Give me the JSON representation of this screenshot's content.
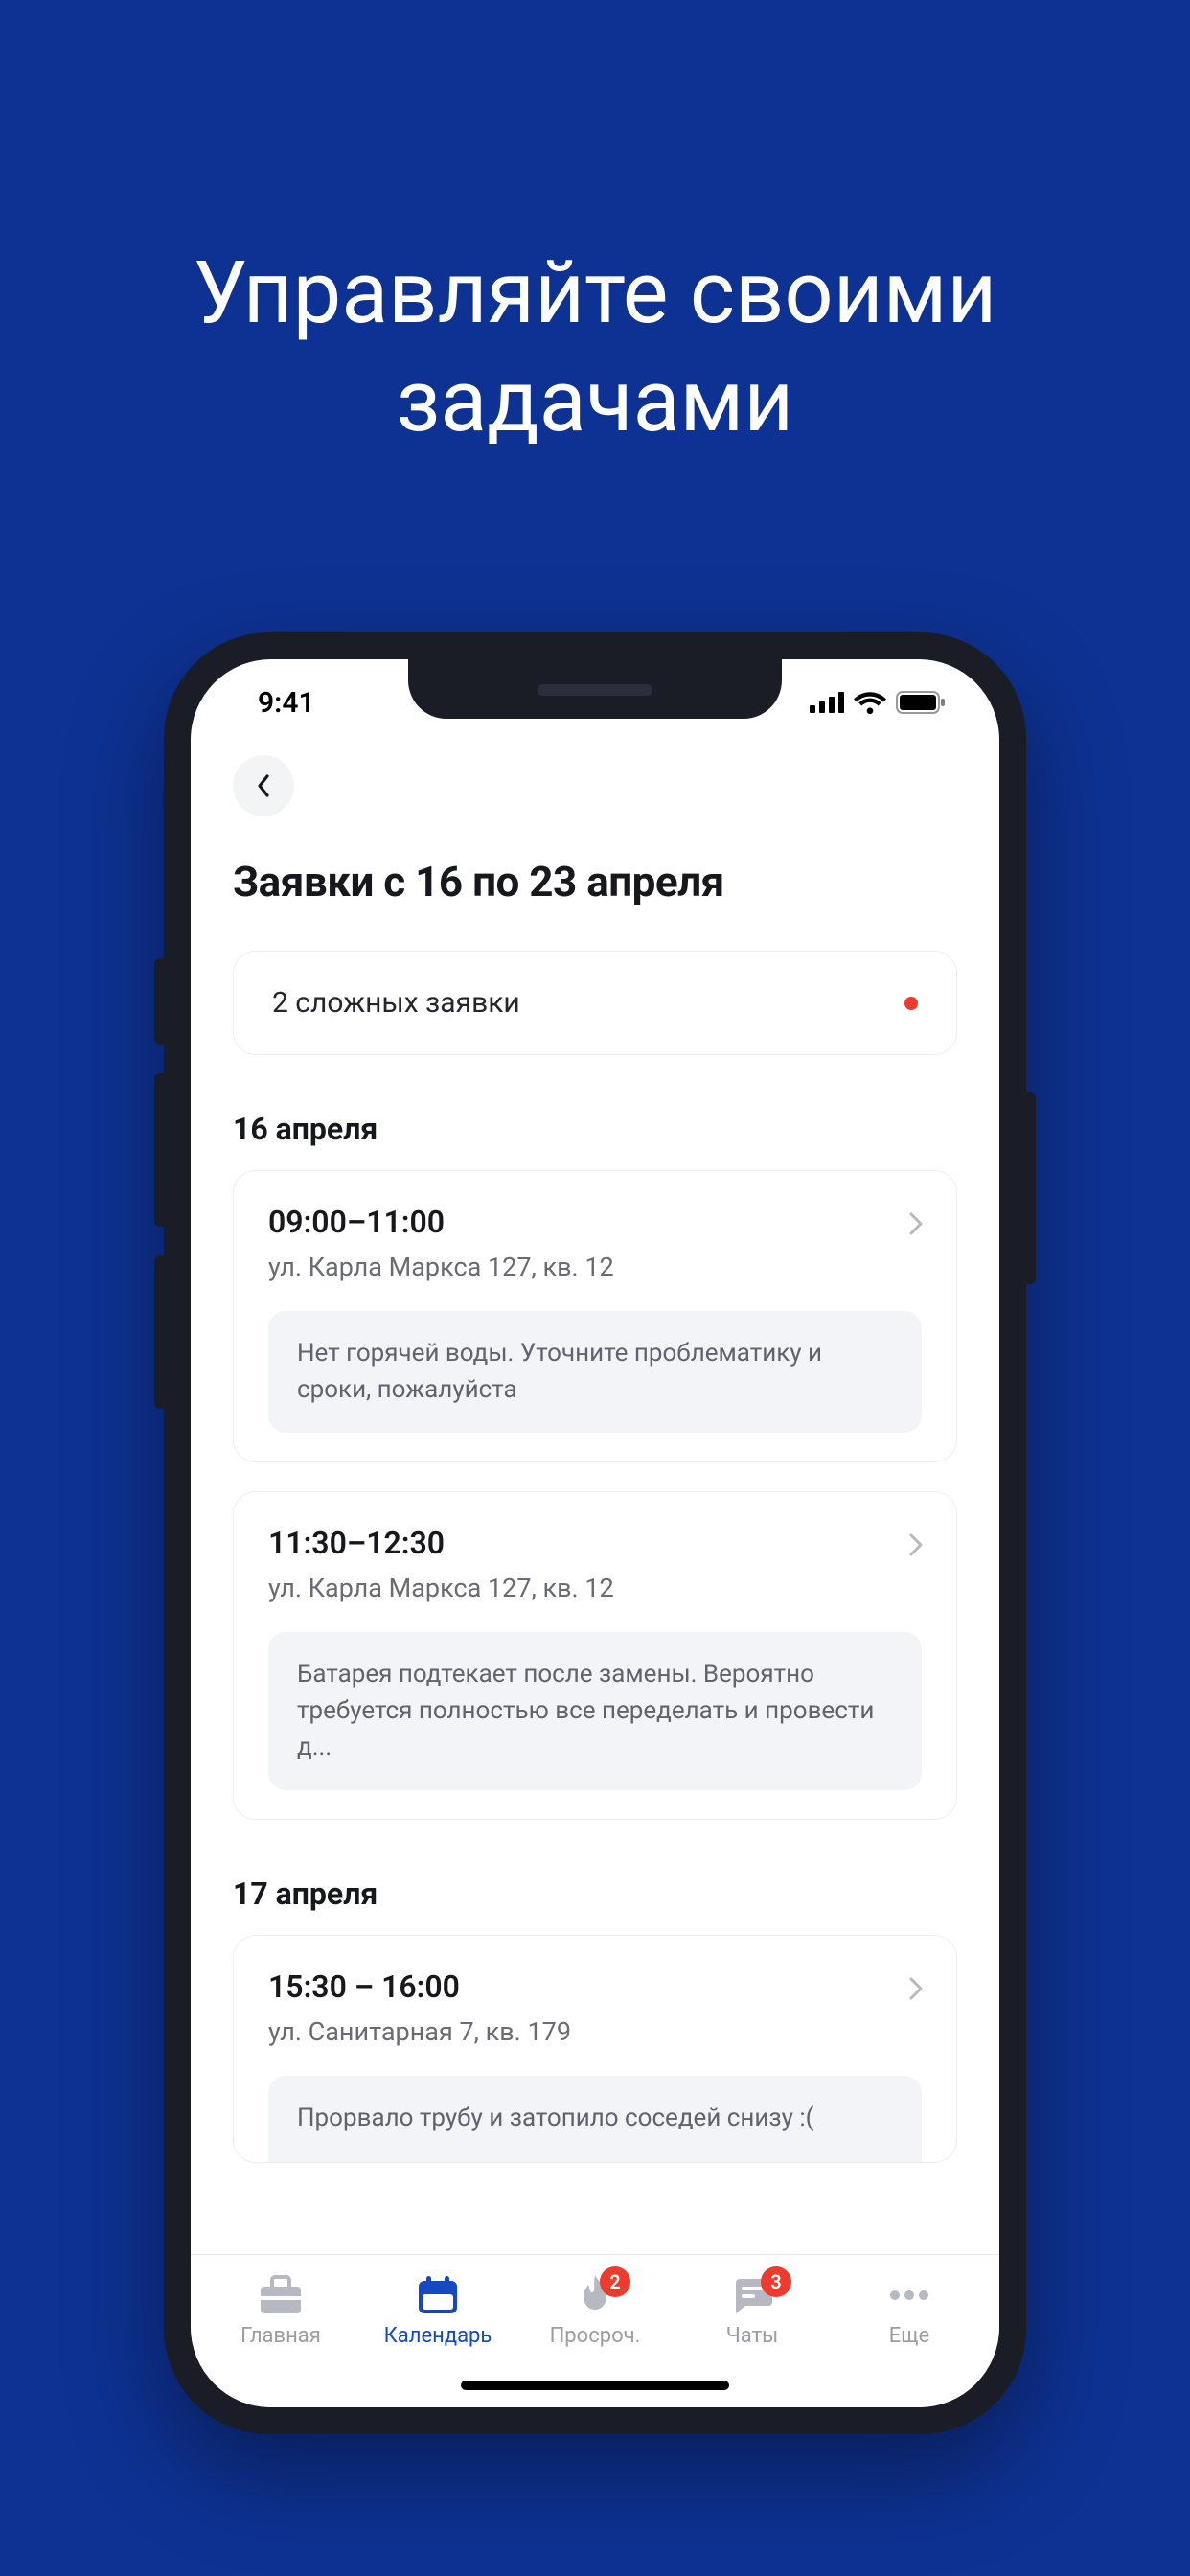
{
  "promo": {
    "title_line1": "Управляйте своими",
    "title_line2": "задачами"
  },
  "status": {
    "time": "9:41"
  },
  "header": {
    "page_title": "Заявки с 16 по 23 апреля"
  },
  "alert": {
    "label": "2 сложных заявки"
  },
  "days": [
    {
      "label": "16 апреля",
      "tasks": [
        {
          "time": "09:00–11:00",
          "address": "ул. Карла Маркса 127, кв. 12",
          "desc": "Нет горячей воды. Уточните проблематику и сроки, пожалуйста"
        },
        {
          "time": "11:30–12:30",
          "address": "ул. Карла Маркса 127, кв. 12",
          "desc": "Батарея подтекает после замены. Вероятно требуется полностью все переделать и провести д..."
        }
      ]
    },
    {
      "label": "17 апреля",
      "tasks": [
        {
          "time": "15:30 – 16:00",
          "address": "ул. Санитарная 7, кв. 179",
          "desc": "Прорвало трубу и затопило соседей снизу :("
        }
      ]
    }
  ],
  "tabs": {
    "home": {
      "label": "Главная"
    },
    "calendar": {
      "label": "Календарь"
    },
    "overdue": {
      "label": "Просроч.",
      "badge": "2"
    },
    "chats": {
      "label": "Чаты",
      "badge": "3"
    },
    "more": {
      "label": "Еще"
    }
  }
}
